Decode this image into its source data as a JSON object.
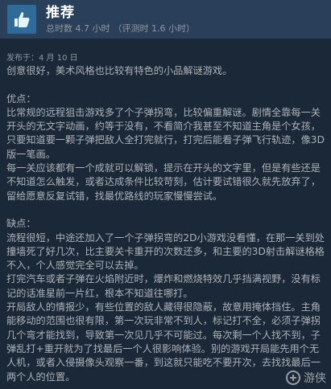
{
  "header": {
    "verdict": "推荐",
    "hours_on_record": "总时数 4.7 小时",
    "hours_at_review": "（评测时 1.6 小时）",
    "icon": "thumbs-up-icon"
  },
  "posted": "发布于：4 月 10 日",
  "body": [
    "创意很好，美术风格也比较有特色的小品解谜游戏。",
    "",
    "优点：",
    "比常规的远程狙击游戏多了个子弹拐弯，比较偏重解谜。剧情全靠每一关开头的无文字动画，约等于没有，不看简介我甚至不知道主角是个女孩，只要知道要一颗子弹把敌人全打完就行，打完后能看子弹飞行轨迹，像3D版一笔画。",
    "每一关应该都有一个成就可以解锁，提示在开头的文字里，但是有些还是不知道怎么触发，或者达成条件比较苛刻，估计要试错很久就先放弃了，留给愿意反复试错，找最优路线的玩家慢慢尝试。",
    "",
    "缺点：",
    "流程很短，中途还加入了一个子弹拐弯的2D小游戏没看懂，在那一关到处撞墙死了好几次，比主要关卡重开的次数还多，和主要的3D射击解谜格格不入，个人感觉完全可以去掉。",
    "打完汽车或者子弹在火焰附近时，爆炸和燃烧特效几乎挡满视野，没有标记的话准星前一片红，根本不知道往哪打。",
    "开局敌人的情报少，有些位置的敌人藏得很隐蔽，故意用掩体挡住。主角能移动的范围也很有限，第一次玩非常不到人，标记打不全，必须子弹拐几个弯才能找到，导致第一次见几乎不可能过。每次剩一个人找不到，子弹乱打+重开就为了找最后一个人很影响体验。别的游戏开局能先用个无人机，或者入侵摄像头观察一番，到这就只能吃不要开次，去找找最后一两个人的位置。"
  ],
  "watermark": {
    "text": "游侠",
    "icon": "gamersky-logo-icon"
  },
  "colors": {
    "background": "#1b2838",
    "header": "#2a3f5a",
    "thumb_box": "#2f6a99",
    "text": "#acb2b8"
  }
}
